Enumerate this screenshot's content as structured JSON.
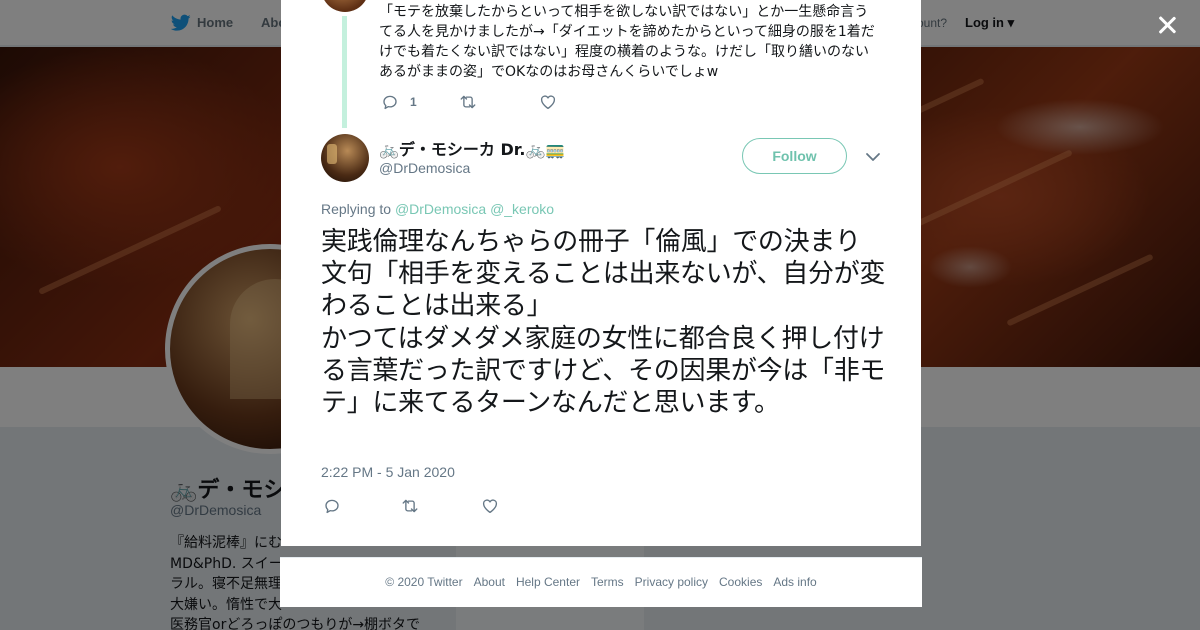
{
  "background": {
    "nav": {
      "home": "Home",
      "about": "Abo",
      "account_prompt": "ccount?",
      "login": "Log in"
    },
    "profile": {
      "name": "デ・モシ",
      "handle": "@DrDemosica",
      "bio_lines": [
        "『給料泥棒』にむ",
        "MD&PhD. スイー",
        "ラル。寝不足無理",
        "大嫌い。惰性で大",
        "医務官orどろっぽのつもりが→棚ボタで"
      ]
    }
  },
  "parent_tweet": {
    "text": "「モテを放棄したからといって相手を欲しない訳ではない」とか一生懸命言うてる人を見かけましたが→「ダイエットを諦めたからといって細身の服を1着だけでも着たくない訳ではない」程度の横着のような。けだし「取り繕いのないあるがままの姿」でOKなのはお母さんくらいでしょw",
    "reply_count": "1"
  },
  "tweet": {
    "display_name": "デ・モシーカ Dr.",
    "handle": "@DrDemosica",
    "follow_label": "Follow",
    "replying_prefix": "Replying to",
    "replying_to": [
      "@DrDemosica",
      "@_keroko"
    ],
    "text": "実践倫理なんちゃらの冊子「倫風」での決まり文句「相手を変えることは出来ないが、自分が変わることは出来る」\nかつてはダメダメ家庭の女性に都合良く押し付ける言葉だった訳ですけど、その因果が今は「非モテ」に来てるターンなんだと思います。",
    "timestamp": "2:22 PM - 5 Jan 2020"
  },
  "icons": {
    "close": "close-icon",
    "reply": "reply-icon",
    "retweet": "retweet-icon",
    "like": "heart-icon",
    "caret": "chevron-down-icon",
    "brand": "twitter-bird-icon",
    "bicycle": "bicycle-icon",
    "emoji_extra": "railway-icon"
  },
  "colors": {
    "accent": "#79c7b4",
    "secondary_text": "#657786",
    "primary_text": "#14171a"
  },
  "footer": {
    "copyright": "© 2020 Twitter",
    "links": [
      "About",
      "Help Center",
      "Terms",
      "Privacy policy",
      "Cookies",
      "Ads info"
    ]
  }
}
